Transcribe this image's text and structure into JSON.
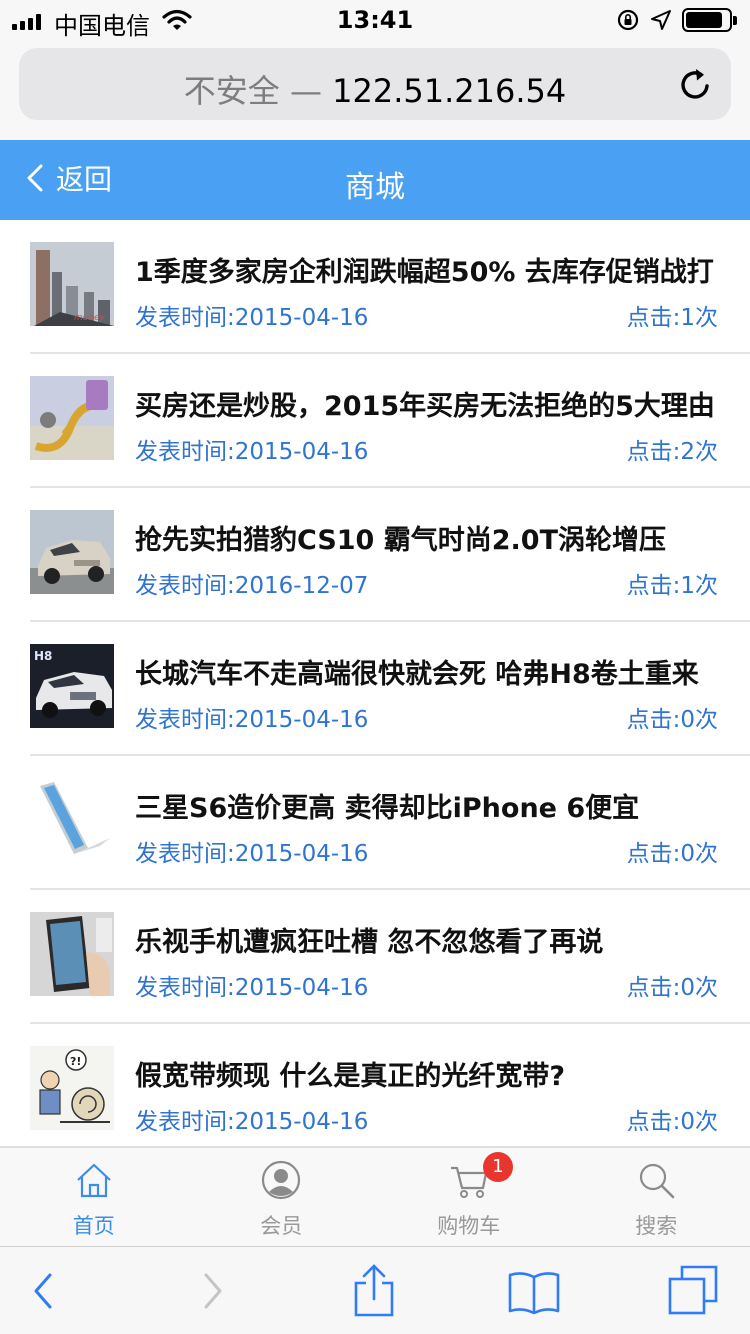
{
  "status_bar": {
    "carrier": "中国电信",
    "time": "13:41",
    "battery_level": 0.85
  },
  "url_bar": {
    "security_label": "不安全 — ",
    "host": "122.51.216.54"
  },
  "header": {
    "back_label": "返回",
    "title": "商城",
    "accent_color": "#4aa1f3"
  },
  "articles": [
    {
      "title": "1季度多家房企利润跌幅超50% 去库存促销战打",
      "date": "发表时间:2015-04-16",
      "clicks": "点击:1次",
      "thumb_icon": "building-photo"
    },
    {
      "title": "买房还是炒股，2015年买房无法拒绝的5大理由",
      "date": "发表时间:2015-04-16",
      "clicks": "点击:2次",
      "thumb_icon": "stock-cartoon-photo"
    },
    {
      "title": "抢先实拍猎豹CS10 霸气时尚2.0T涡轮增压",
      "date": "发表时间:2016-12-07",
      "clicks": "点击:1次",
      "thumb_icon": "suv-photo"
    },
    {
      "title": "长城汽车不走高端很快就会死 哈弗H8卷土重来",
      "date": "发表时间:2015-04-16",
      "clicks": "点击:0次",
      "thumb_icon": "car-show-photo"
    },
    {
      "title": "三星S6造价更高 卖得却比iPhone 6便宜",
      "date": "发表时间:2015-04-16",
      "clicks": "点击:0次",
      "thumb_icon": "smartphone-photo"
    },
    {
      "title": "乐视手机遭疯狂吐槽 忽不忽悠看了再说",
      "date": "发表时间:2015-04-16",
      "clicks": "点击:0次",
      "thumb_icon": "phone-hand-photo"
    },
    {
      "title": "假宽带频现 什么是真正的光纤宽带?",
      "date": "发表时间:2015-04-16",
      "clicks": "点击:0次",
      "thumb_icon": "snail-cartoon-photo"
    }
  ],
  "tabs": [
    {
      "label": "首页",
      "icon": "home-icon",
      "active": true
    },
    {
      "label": "会员",
      "icon": "user-icon",
      "active": false
    },
    {
      "label": "购物车",
      "icon": "cart-icon",
      "active": false,
      "badge": "1"
    },
    {
      "label": "搜索",
      "icon": "search-icon",
      "active": false
    }
  ],
  "colors": {
    "link_blue": "#2f74d0",
    "tab_active": "#3b8ee8",
    "badge_red": "#e8362f"
  }
}
